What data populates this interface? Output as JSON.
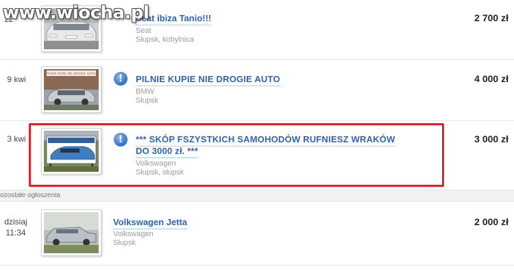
{
  "watermark": "www.wiocha.pl",
  "section_label": "ozostałe ogłoszenia",
  "listings": [
    {
      "date": "22",
      "title": "Seat ibiza Tanio!!!",
      "category": "Seat",
      "location": "Słupsk, kobylnica",
      "price": "2 700 zł",
      "promoted": false
    },
    {
      "date": "9 kwi",
      "title": "PILNIE KUPIE NIE DROGIE AUTO",
      "category": "BMW",
      "location": "Słupsk",
      "price": "4 000 zł",
      "promoted": true,
      "thumb_caption": "PILNIE KUPIE NIE DROGIE AUTO"
    },
    {
      "date": "3 kwi",
      "title_line1": "*** SKÓP FSZYSTKICH SAMOHODÓW RUFNIESZ WRAKÓW",
      "title_line2": "DO 3000 zł. ***",
      "category": "Volkswagen",
      "location": "Słupsk, słupsk",
      "price": "3 000 zł",
      "promoted": true
    },
    {
      "date_line1": "dzisiaj",
      "date_line2": "11:34",
      "title": "Volkswagen Jetta",
      "category": "Volkswagen",
      "location": "Słupsk",
      "price": "2 000 zł",
      "promoted": false
    }
  ],
  "icons": {
    "promo": "info-exclamation-icon",
    "promo_glyph": "!"
  },
  "colors": {
    "link": "#2b63b6",
    "highlight": "#d9242e",
    "meta": "#9a9a9a"
  }
}
